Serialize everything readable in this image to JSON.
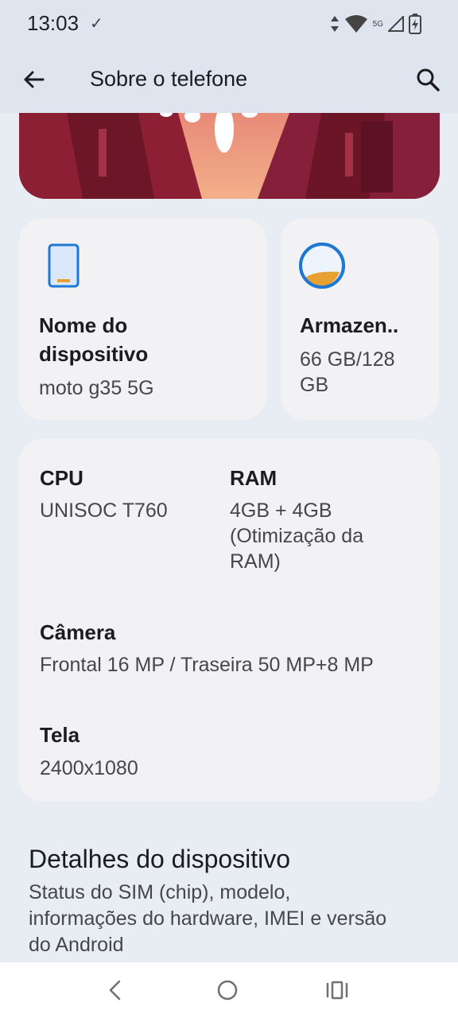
{
  "status_bar": {
    "time": "13:03",
    "check_glyph": "✓",
    "network_label": "5G"
  },
  "app_bar": {
    "title": "Sobre o telefone"
  },
  "device_card": {
    "label_line1": "Nome do",
    "label_line2": "dispositivo",
    "value": "moto g35 5G"
  },
  "storage_card": {
    "label": "Armazen..",
    "value_line1": "66 GB/128",
    "value_line2": "GB"
  },
  "specs": {
    "cpu_label": "CPU",
    "cpu_value": "UNISOC T760",
    "ram_label": "RAM",
    "ram_line1": "4GB + 4GB",
    "ram_line2": "(Otimização da",
    "ram_line3": "RAM)",
    "camera_label": "Câmera",
    "camera_value": "Frontal 16 MP / Traseira 50 MP+8 MP",
    "screen_label": "Tela",
    "screen_value": "2400x1080"
  },
  "details": {
    "title": "Detalhes do dispositivo",
    "sub_line1": "Status do SIM (chip), modelo,",
    "sub_line2": "informações do hardware, IMEI e versão",
    "sub_line3": "do Android"
  },
  "icons": {
    "back": "back-arrow-icon",
    "search": "search-icon",
    "nav_back": "nav-back-icon",
    "nav_home": "nav-home-icon",
    "nav_recents": "nav-recents-icon"
  },
  "colors": {
    "background": "#e8ecf3",
    "card": "#f2f1f3",
    "accent_blue": "#1e78d4",
    "accent_orange": "#e8a030"
  }
}
